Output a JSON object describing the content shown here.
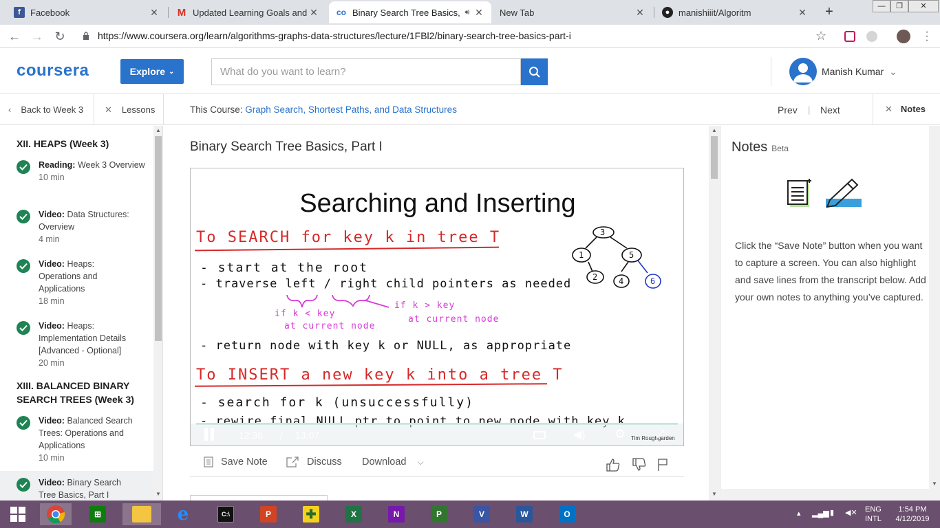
{
  "browser": {
    "tabs": [
      {
        "title": "Facebook",
        "active": false
      },
      {
        "title": "Updated Learning Goals and Tin",
        "active": false
      },
      {
        "title": "Binary Search Tree Basics, Pa",
        "active": true
      },
      {
        "title": "New Tab",
        "active": false
      },
      {
        "title": "manishiiit/Algoritm",
        "active": false
      }
    ],
    "url": "https://www.coursera.org/learn/algorithms-graphs-data-structures/lecture/1FBl2/binary-search-tree-basics-part-i"
  },
  "header": {
    "logo": "coursera",
    "explore_label": "Explore",
    "search_placeholder": "What do you want to learn?",
    "user_name": "Manish Kumar"
  },
  "coursebar": {
    "back_label": "Back to Week 3",
    "lessons_label": "Lessons",
    "course_prefix": "This Course: ",
    "course_name": "Graph Search, Shortest Paths, and Data Structures",
    "prev_label": "Prev",
    "next_label": "Next",
    "notes_label": "Notes"
  },
  "sidebar": {
    "modules": [
      {
        "title": "XII. HEAPS (Week 3)"
      },
      {
        "title": "XIII. BALANCED BINARY SEARCH TREES (Week 3)"
      }
    ],
    "lessons": [
      {
        "kind": "Reading:",
        "name": "Week 3 Overview",
        "duration": "10 min"
      },
      {
        "kind": "Video:",
        "name": "Data Structures: Overview",
        "duration": "4 min"
      },
      {
        "kind": "Video:",
        "name": "Heaps: Operations and Applications",
        "duration": "18 min"
      },
      {
        "kind": "Video:",
        "name": "Heaps: Implementation Details [Advanced - Optional]",
        "duration": "20 min"
      },
      {
        "kind": "Video:",
        "name": "Balanced Search Trees: Operations and Applications",
        "duration": "10 min"
      },
      {
        "kind": "Video:",
        "name": "Binary Search Tree Basics, Part I",
        "duration": ""
      }
    ]
  },
  "main": {
    "lecture_title": "Binary Search Tree Basics, Part I",
    "slide": {
      "title": "Searching and Inserting",
      "search_heading": "To SEARCH for key k in tree T",
      "search_line1": "- start  at  the  root",
      "search_line2": "- traverse  left / right  child  pointers  as  needed",
      "note_left_1": "if k < key",
      "note_left_2": "at current node",
      "note_right_1": "if k > key",
      "note_right_2": "at current node",
      "search_line3": "- return  node  with  key  k  or  NULL,  as  appropriate",
      "insert_heading": "To INSERT a new key k into a tree T",
      "insert_line1": "- search  for  k  (unsuccessfully)",
      "insert_line2": "- rewire  final  NULL  ptr  to  point  to  new  node  with  key  k",
      "tree_nodes": [
        "3",
        "1",
        "5",
        "2",
        "4",
        "6"
      ],
      "author": "Tim Roughgarden"
    },
    "player": {
      "current_time": "12:36",
      "separator": "/",
      "total_time": "13:07"
    },
    "actions": {
      "save_note": "Save Note",
      "discuss": "Discuss",
      "download": "Download"
    }
  },
  "notes": {
    "title": "Notes",
    "badge": "Beta",
    "description": "Click the “Save Note” button when you want to capture a screen. You can also highlight and save lines from the transcript below. Add your own notes to anything you’ve captured."
  },
  "taskbar": {
    "lang_line1": "ENG",
    "lang_line2": "INTL",
    "time": "1:54 PM",
    "date": "4/12/2019"
  },
  "colors": {
    "brand": "#2a73cc",
    "complete": "#1f8354",
    "ink_red": "#d62828",
    "ink_magenta": "#d83ad8",
    "ink_blue": "#1e35c8"
  }
}
